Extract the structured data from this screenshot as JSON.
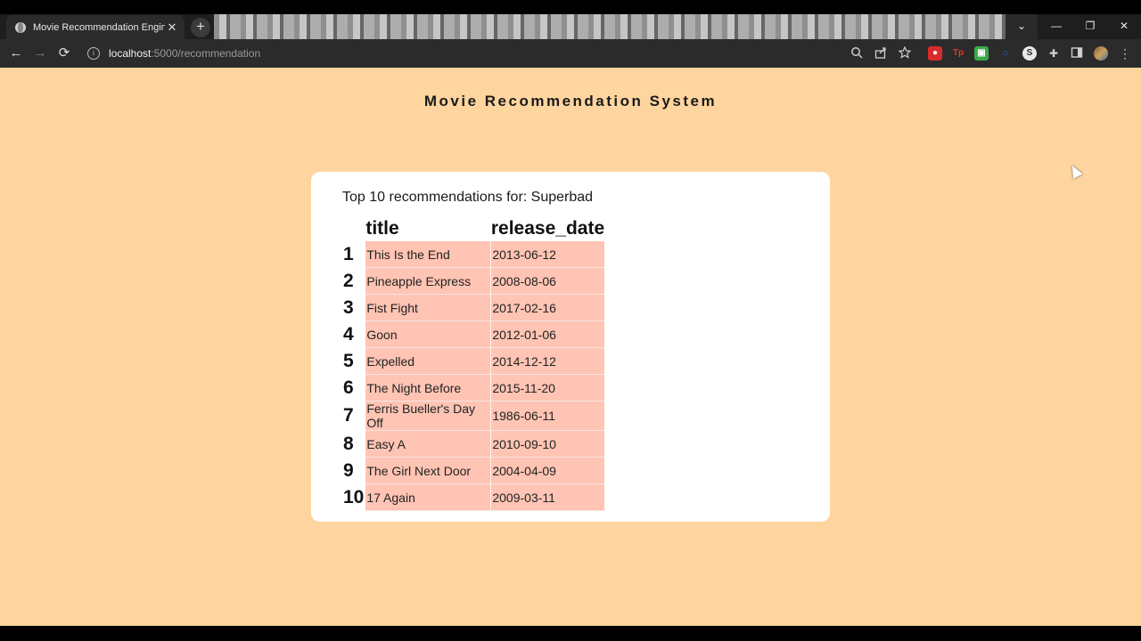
{
  "browser": {
    "tab_title": "Movie Recommendation Engine",
    "tab_close": "✕",
    "new_tab": "+",
    "url_host": "localhost",
    "url_path": ":5000/recommendation",
    "window_controls": {
      "dropdown": "⌄",
      "minimize": "—",
      "maximize": "❐",
      "close": "✕"
    },
    "nav": {
      "back": "←",
      "forward": "→",
      "reload": "⟳"
    },
    "toolbar_icons": [
      "zoom-icon",
      "share-icon",
      "bookmark-star-icon",
      "extension-icons",
      "puzzle-icon",
      "sidepanel-icon",
      "profile-avatar",
      "kebab-menu-icon"
    ]
  },
  "page": {
    "heading": "Movie Recommendation System",
    "subtitle": "Top 10 recommendations for: Superbad",
    "background_color": "#ffd59f",
    "table": {
      "columns": [
        "title",
        "release_date"
      ],
      "rows": [
        {
          "index": "1",
          "title": "This Is the End",
          "release_date": "2013-06-12"
        },
        {
          "index": "2",
          "title": "Pineapple Express",
          "release_date": "2008-08-06"
        },
        {
          "index": "3",
          "title": "Fist Fight",
          "release_date": "2017-02-16"
        },
        {
          "index": "4",
          "title": "Goon",
          "release_date": "2012-01-06"
        },
        {
          "index": "5",
          "title": "Expelled",
          "release_date": "2014-12-12"
        },
        {
          "index": "6",
          "title": "The Night Before",
          "release_date": "2015-11-20"
        },
        {
          "index": "7",
          "title": "Ferris Bueller's Day Off",
          "release_date": "1986-06-11"
        },
        {
          "index": "8",
          "title": "Easy A",
          "release_date": "2010-09-10"
        },
        {
          "index": "9",
          "title": "The Girl Next Door",
          "release_date": "2004-04-09"
        },
        {
          "index": "10",
          "title": "17 Again",
          "release_date": "2009-03-11"
        }
      ],
      "cell_color": "#ffc4b3"
    }
  }
}
